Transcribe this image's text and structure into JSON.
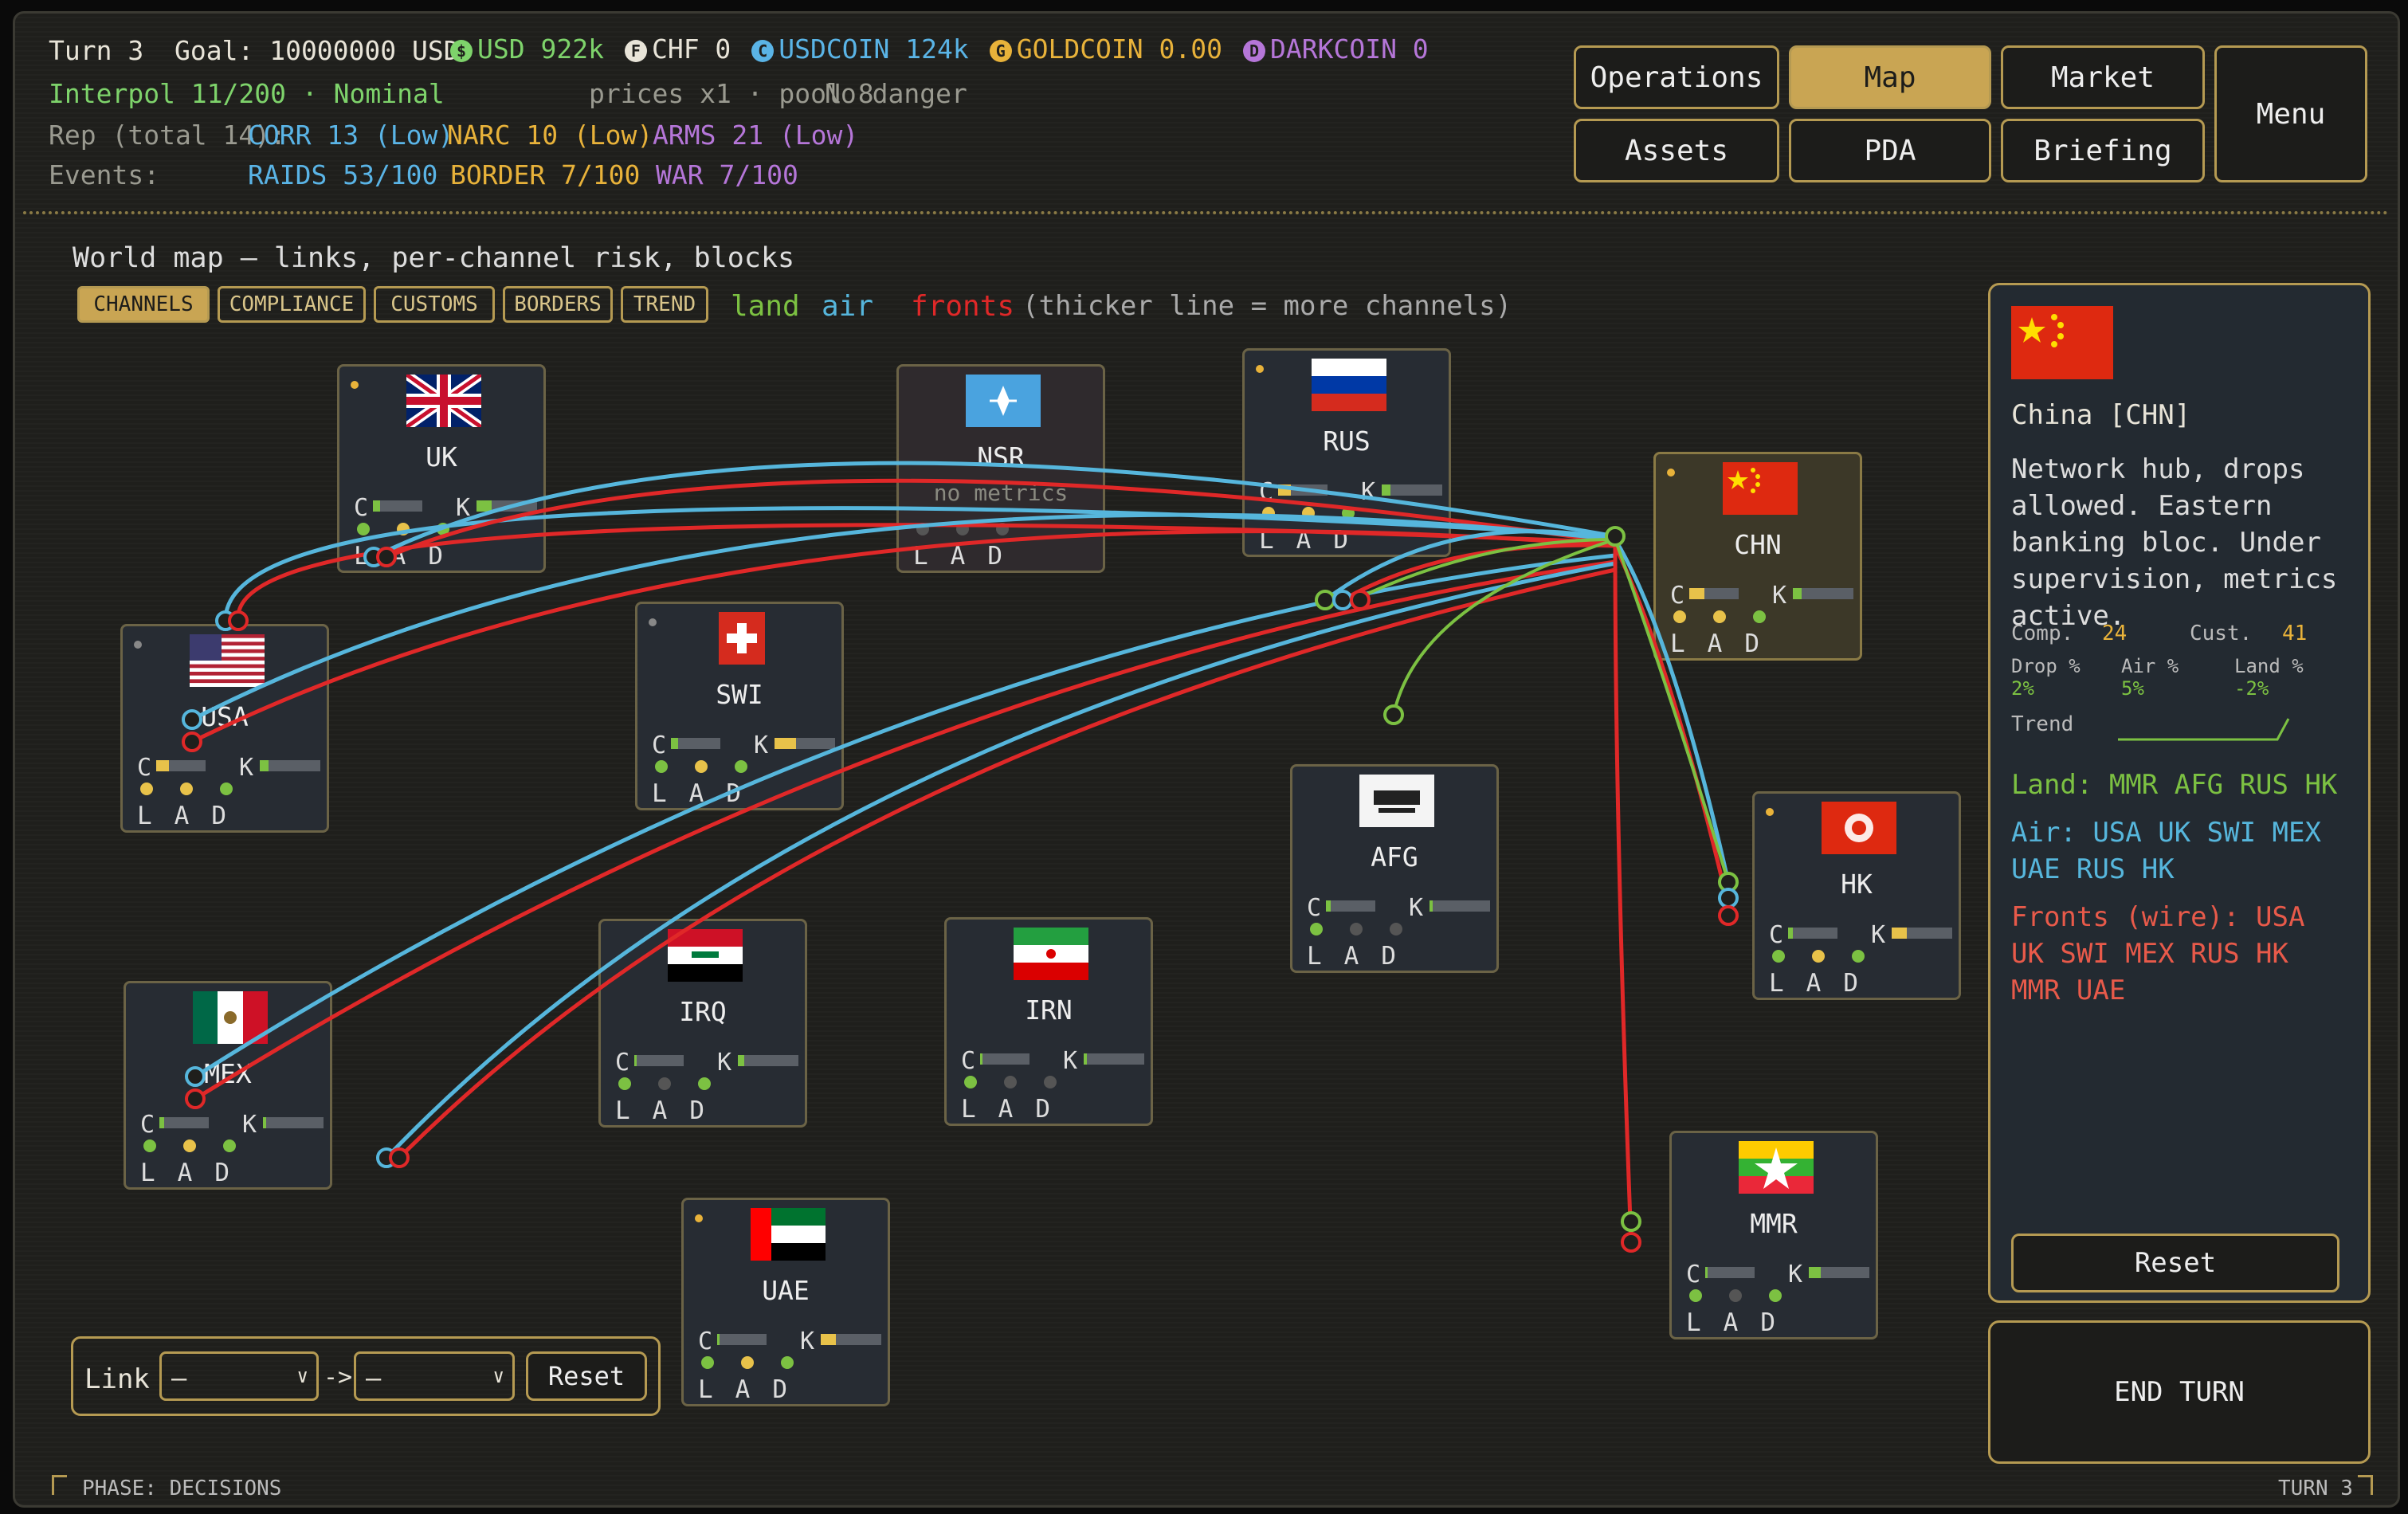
{
  "header": {
    "turn": "Turn 3",
    "goal": "Goal: 10000000 USD",
    "currencies": [
      {
        "glyph": "$",
        "label": "USD 922k",
        "color": "#7ed36b"
      },
      {
        "glyph": "F",
        "label": "CHF 0",
        "color": "#e8e4d8"
      },
      {
        "glyph": "C",
        "label": "USDCOIN 124k",
        "color": "#5ab4e6"
      },
      {
        "glyph": "G",
        "label": "GOLDCOIN 0.00",
        "color": "#e8b23a"
      },
      {
        "glyph": "D",
        "label": "DARKCOIN 0",
        "color": "#b576d8"
      }
    ],
    "interpol": "Interpol 11/200 · Nominal",
    "prices": "prices x1 · pool 8",
    "danger": "No danger",
    "rep_label": "Rep (total 14):",
    "rep": [
      {
        "label": "CORR 13 (Low)",
        "color": "#5ab4e6"
      },
      {
        "label": "NARC 10 (Low)",
        "color": "#e8b23a"
      },
      {
        "label": "ARMS 21 (Low)",
        "color": "#b576d8"
      }
    ],
    "events_label": "Events:",
    "events": [
      {
        "label": "RAIDS 53/100",
        "color": "#5ab4e6"
      },
      {
        "label": "BORDER 7/100",
        "color": "#e8b23a"
      },
      {
        "label": "WAR 7/100",
        "color": "#b576d8"
      }
    ]
  },
  "nav": {
    "operations": "Operations",
    "map": "Map",
    "market": "Market",
    "assets": "Assets",
    "pda": "PDA",
    "briefing": "Briefing",
    "menu": "Menu"
  },
  "map": {
    "title": "World map — links, per-channel risk, blocks",
    "tabs": [
      "CHANNELS",
      "COMPLIANCE",
      "CUSTOMS",
      "BORDERS",
      "TREND"
    ],
    "active_tab": "CHANNELS",
    "legend": {
      "land": "land",
      "air": "air",
      "fronts": "fronts",
      "note": "(thicker line = more channels)"
    },
    "colors": {
      "land": "#7cc142",
      "air": "#56b6dc",
      "fronts": "#e02828"
    }
  },
  "countries": {
    "UK": {
      "code": "UK"
    },
    "NSR": {
      "code": "NSR",
      "sub": "no metrics"
    },
    "RUS": {
      "code": "RUS"
    },
    "CHN": {
      "code": "CHN"
    },
    "USA": {
      "code": "USA"
    },
    "SWI": {
      "code": "SWI"
    },
    "AFG": {
      "code": "AFG"
    },
    "HK": {
      "code": "HK"
    },
    "MEX": {
      "code": "MEX"
    },
    "IRQ": {
      "code": "IRQ"
    },
    "IRN": {
      "code": "IRN"
    },
    "UAE": {
      "code": "UAE"
    },
    "MMR": {
      "code": "MMR"
    }
  },
  "node_labels": {
    "c": "C",
    "k": "K",
    "lad": "LAD"
  },
  "link": {
    "label": "Link",
    "from": "—",
    "to": "—",
    "arrow": "->",
    "reset": "Reset"
  },
  "sidebar": {
    "country": "China [CHN]",
    "description": "Network hub, drops allowed. Eastern banking bloc. Under supervision, metrics active.",
    "comp_label": "Comp.",
    "comp_value": "24",
    "cust_label": "Cust.",
    "cust_value": "41",
    "drop_label": "Drop %",
    "drop_value": "2%",
    "air_label": "Air %",
    "air_value": "5%",
    "landpct_label": "Land %",
    "landpct_value": "-2%",
    "trend_label": "Trend",
    "land": "Land: MMR AFG RUS HK",
    "air": "Air: USA UK SWI MEX UAE RUS HK",
    "fronts": "Fronts (wire): USA UK SWI MEX RUS HK MMR UAE",
    "reset": "Reset"
  },
  "end_turn": "END TURN",
  "footer": {
    "phase": "PHASE: DECISIONS",
    "turn": "TURN 3"
  }
}
